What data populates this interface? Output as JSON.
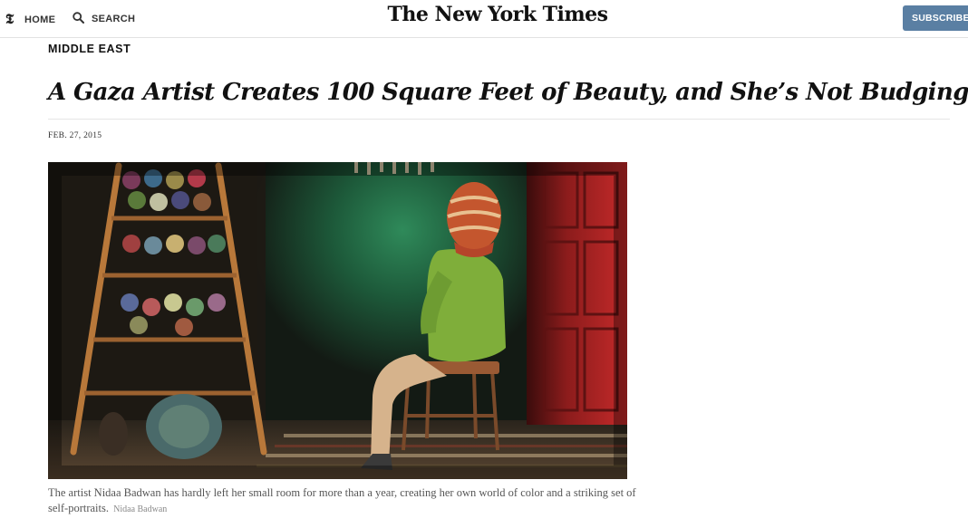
{
  "nav": {
    "home_label": "HOME",
    "search_label": "SEARCH",
    "subscribe_label": "SUBSCRIBE NOW",
    "icons": {
      "brand": "nyt-t-icon",
      "search": "search-icon"
    }
  },
  "masthead": {
    "logo_text": "The New York Times"
  },
  "article": {
    "section": "MIDDLE EAST",
    "headline": "A Gaza Artist Creates 100 Square Feet of Beauty, and She’s Not Budging",
    "date": "FEB. 27, 2015",
    "caption": "The artist Nidaa Badwan has hardly left her small room for more than a year, creating her own world of color and a striking set of self-portraits.",
    "credit": "Nidaa Badwan"
  },
  "colors": {
    "subscribe_bg": "#5a7fa3",
    "text": "#121212",
    "caption": "#555555"
  }
}
